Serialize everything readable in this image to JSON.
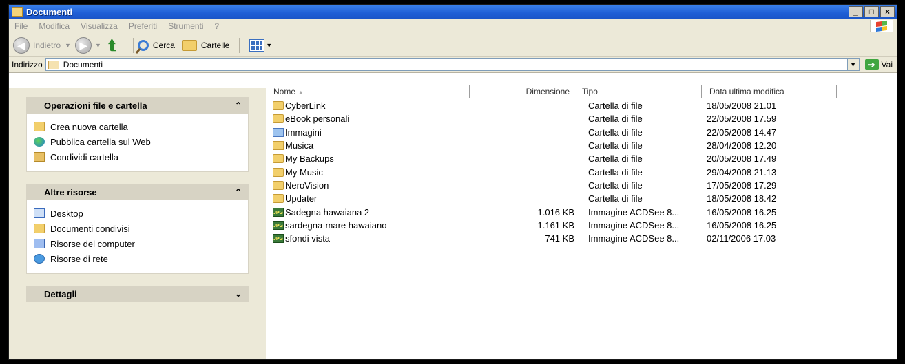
{
  "window": {
    "title": "Documenti"
  },
  "menu": [
    "File",
    "Modifica",
    "Visualizza",
    "Preferiti",
    "Strumenti",
    "?"
  ],
  "toolbar": {
    "back": "Indietro",
    "search": "Cerca",
    "folders": "Cartelle"
  },
  "address": {
    "label": "Indirizzo",
    "value": "Documenti",
    "go": "Vai"
  },
  "tasks": {
    "file_ops": {
      "title": "Operazioni file e cartella",
      "items": [
        "Crea nuova cartella",
        "Pubblica cartella sul Web",
        "Condividi cartella"
      ]
    },
    "other": {
      "title": "Altre risorse",
      "items": [
        "Desktop",
        "Documenti condivisi",
        "Risorse del computer",
        "Risorse di rete"
      ]
    },
    "details": {
      "title": "Dettagli"
    }
  },
  "columns": {
    "name": "Nome",
    "size": "Dimensione",
    "type": "Tipo",
    "date": "Data ultima modifica"
  },
  "files": [
    {
      "icon": "folder",
      "name": "CyberLink",
      "size": "",
      "type": "Cartella di file",
      "date": "18/05/2008 21.01"
    },
    {
      "icon": "folder",
      "name": "eBook personali",
      "size": "",
      "type": "Cartella di file",
      "date": "22/05/2008 17.59"
    },
    {
      "icon": "img",
      "name": "Immagini",
      "size": "",
      "type": "Cartella di file",
      "date": "22/05/2008 14.47"
    },
    {
      "icon": "music",
      "name": "Musica",
      "size": "",
      "type": "Cartella di file",
      "date": "28/04/2008 12.20"
    },
    {
      "icon": "folder",
      "name": "My Backups",
      "size": "",
      "type": "Cartella di file",
      "date": "20/05/2008 17.49"
    },
    {
      "icon": "folder",
      "name": "My Music",
      "size": "",
      "type": "Cartella di file",
      "date": "29/04/2008 21.13"
    },
    {
      "icon": "folder",
      "name": "NeroVision",
      "size": "",
      "type": "Cartella di file",
      "date": "17/05/2008 17.29"
    },
    {
      "icon": "folder",
      "name": "Updater",
      "size": "",
      "type": "Cartella di file",
      "date": "18/05/2008 18.42"
    },
    {
      "icon": "jpg",
      "name": "Sadegna hawaiana 2",
      "size": "1.016 KB",
      "type": "Immagine ACDSee 8...",
      "date": "16/05/2008 16.25"
    },
    {
      "icon": "jpg",
      "name": "sardegna-mare hawaiano",
      "size": "1.161 KB",
      "type": "Immagine ACDSee 8...",
      "date": "16/05/2008 16.25"
    },
    {
      "icon": "jpg",
      "name": "sfondi vista",
      "size": "741 KB",
      "type": "Immagine ACDSee 8...",
      "date": "02/11/2006 17.03"
    }
  ]
}
